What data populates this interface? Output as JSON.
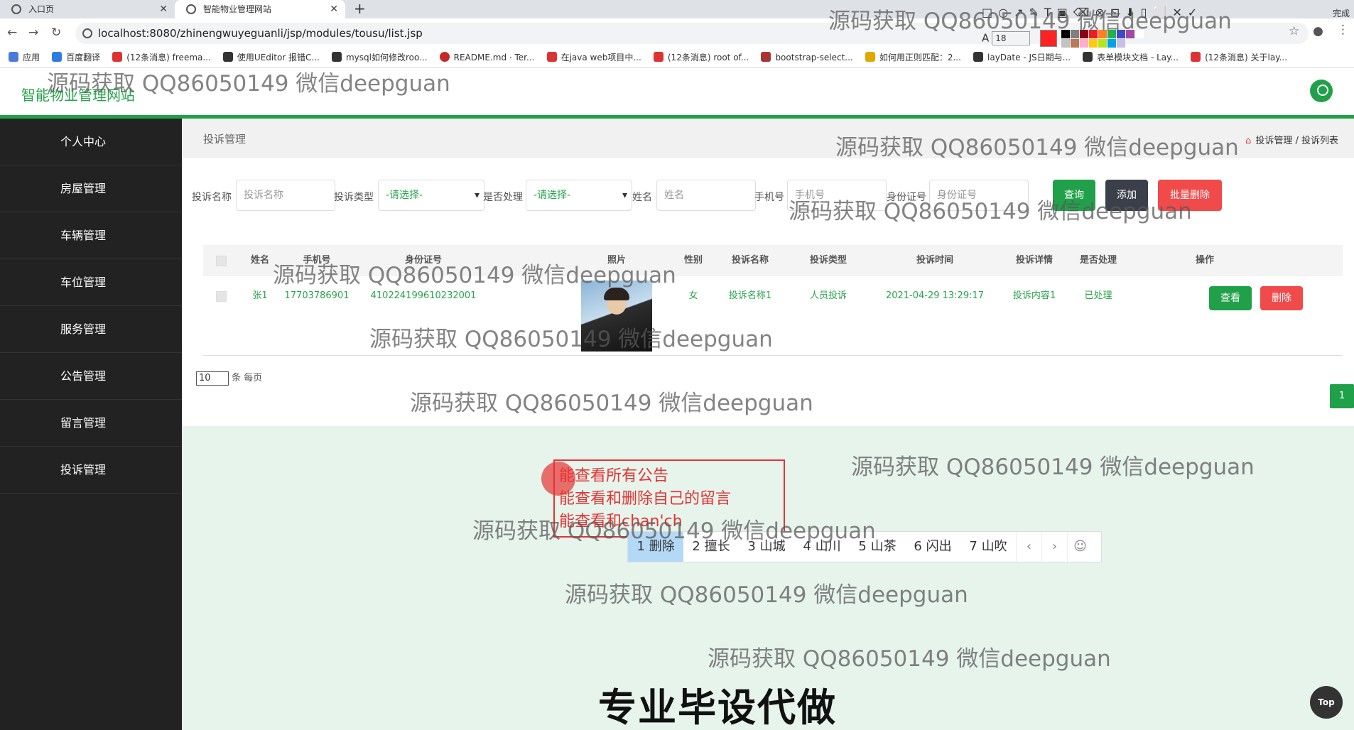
{
  "browser": {
    "tabs": [
      {
        "label": "入口页"
      },
      {
        "label": "智能物业管理网站"
      }
    ],
    "new_tab": "+",
    "url": "localhost:8080/zhinengwuyeguanli/jsp/modules/tousu/list.jsp",
    "bookmarks": [
      "应用",
      "百度翻译",
      "(12条消息) freema...",
      "使用UEditor 报错C...",
      "mysql如何修改roo...",
      "README.md · Ter...",
      "在java web项目中...",
      "(12条消息) root of...",
      "bootstrap-select...",
      "如何用正则匹配：2...",
      "layDate - JS日期与...",
      "表单模块文档 - Lay...",
      "(12条消息) 关于lay..."
    ],
    "annot_font_size": "18",
    "annot_done": "完成",
    "annot_palette": [
      "#000000",
      "#7f7f7f",
      "#880015",
      "#ed1c24",
      "#ff7f27",
      "#22b14c",
      "#3f48cc",
      "#a349a4",
      "#ffffff",
      "#c3c3c3",
      "#b97a57",
      "#ffaec9",
      "#ffc90e",
      "#b5e61d",
      "#00a2e8",
      "#c8bfe7"
    ]
  },
  "app": {
    "logo": "智能物业管理网站",
    "sidebar": [
      "个人中心",
      "房屋管理",
      "车辆管理",
      "车位管理",
      "服务管理",
      "公告管理",
      "留言管理",
      "投诉管理"
    ],
    "page_title": "投诉管理",
    "breadcrumb": [
      "投诉管理",
      "投诉列表"
    ],
    "search": {
      "name_label": "投诉名称",
      "name_placeholder": "投诉名称",
      "type_label": "投诉类型",
      "type_value": "-请选择-",
      "handled_label": "是否处理",
      "handled_value": "-请选择-",
      "person_label": "姓名",
      "person_placeholder": "姓名",
      "phone_label": "手机号",
      "phone_placeholder": "手机号",
      "id_label": "身份证号",
      "id_placeholder": "身份证号",
      "query_btn": "查询",
      "add_btn": "添加",
      "batch_delete_btn": "批量删除"
    },
    "table": {
      "headers": [
        "姓名",
        "手机号",
        "身份证号",
        "照片",
        "性别",
        "投诉名称",
        "投诉类型",
        "投诉时间",
        "投诉详情",
        "是否处理",
        "操作"
      ],
      "rows": [
        {
          "name": "张1",
          "phone": "17703786901",
          "idcard": "410224199610232001",
          "gender": "女",
          "title": "投诉名称1",
          "type": "人员投诉",
          "time": "2021-04-29 13:29:17",
          "detail": "投诉内容1",
          "handled": "已处理",
          "view": "查看",
          "delete": "删除"
        }
      ]
    },
    "pager": {
      "page_size": "10",
      "page_size_suffix": "条 每页",
      "current_page": "1"
    },
    "colors": {
      "primary": "#21a04a",
      "sidebar": "#222222",
      "danger": "#f04a4a",
      "dark_btn": "#3b3f4a"
    }
  },
  "overlay": {
    "note_lines": [
      "能查看所有公告",
      "能查看和删除自己的留言",
      "能查看和chan'ch"
    ],
    "ime_candidates": [
      "1 删除",
      "2 擅长",
      "3 山城",
      "4 山川",
      "5 山茶",
      "6 闪出",
      "7 山吹"
    ],
    "big_text": "专业毕设代做",
    "top_btn": "Top",
    "watermark": "源码获取 QQ86050149 微信deepguan"
  }
}
